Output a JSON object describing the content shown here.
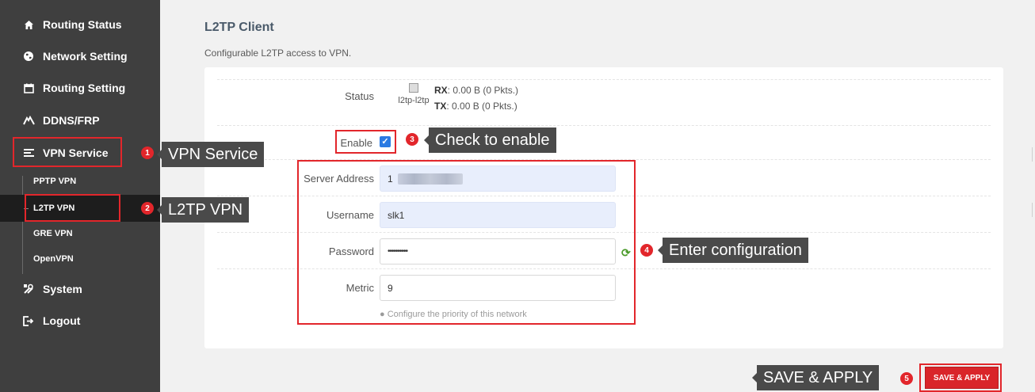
{
  "sidebar": {
    "items": [
      {
        "label": "Routing Status",
        "icon": "home-icon"
      },
      {
        "label": "Network Setting",
        "icon": "globe-icon"
      },
      {
        "label": "Routing Setting",
        "icon": "calendar-icon"
      },
      {
        "label": "DDNS/FRP",
        "icon": "dashboard-icon"
      },
      {
        "label": "VPN Service",
        "icon": "list-icon"
      },
      {
        "label": "System",
        "icon": "tools-icon"
      },
      {
        "label": "Logout",
        "icon": "logout-icon"
      }
    ],
    "vpn_sub_items": [
      "PPTP VPN",
      "L2TP VPN",
      "GRE VPN",
      "OpenVPN"
    ]
  },
  "page": {
    "title": "L2TP Client",
    "description": "Configurable L2TP access to VPN."
  },
  "status": {
    "label": "Status",
    "interface": "l2tp-l2tp",
    "rx_label": "RX",
    "rx_value": ": 0.00 B (0 Pkts.)",
    "tx_label": "TX",
    "tx_value": ": 0.00 B (0 Pkts.)"
  },
  "form": {
    "enable_label": "Enable",
    "enable_checked": true,
    "server_address_label": "Server Address",
    "server_address_value": "1",
    "username_label": "Username",
    "username_value": "slk1",
    "password_label": "Password",
    "password_value": "••••••••••",
    "metric_label": "Metric",
    "metric_value": "9",
    "metric_hint": "Configure the priority of this network"
  },
  "save_button": "SAVE & APPLY",
  "annotations": [
    {
      "number": "1",
      "text": "VPN Service"
    },
    {
      "number": "2",
      "text": "L2TP VPN"
    },
    {
      "number": "3",
      "text": "Check to enable"
    },
    {
      "number": "4",
      "text": "Enter configuration"
    },
    {
      "number": "5",
      "text": "SAVE & APPLY"
    }
  ],
  "colors": {
    "sidebar_bg": "#3f3f3f",
    "sidebar_active": "#1d1d1d",
    "accent_red": "#d9252a",
    "annotation_red": "#e2262b",
    "callout_bg": "#4a4a4a",
    "checkbox_blue": "#2a7ae2"
  }
}
